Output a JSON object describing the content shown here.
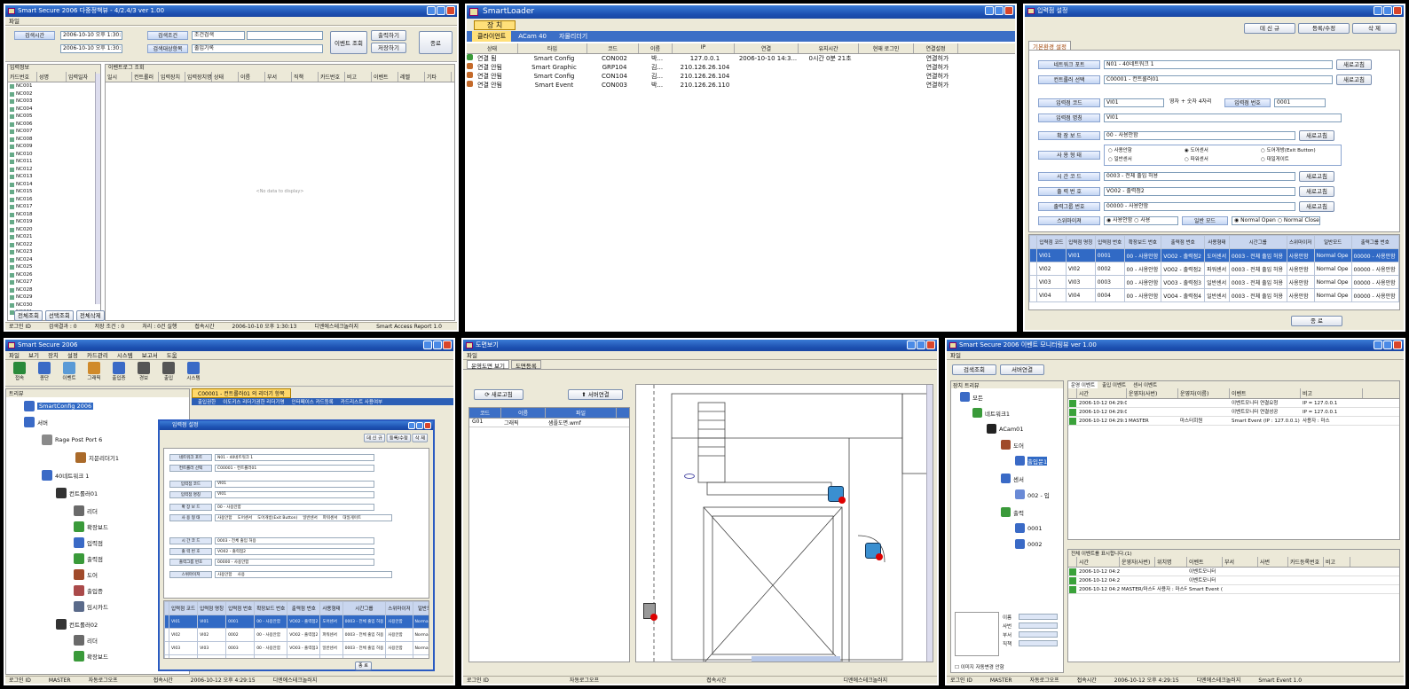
{
  "p1": {
    "title": "Smart Secure 2006 다중정책뷰 - 4/2.4/3 ver 1.00",
    "menu": "파일",
    "labels": {
      "start": "검색시간",
      "end": "",
      "device": "검색조건",
      "group": "검색대상항목"
    },
    "start_val": "2006-10-10 오후 1:30:13",
    "end_val": "2006-10-10 오후 1:30:13",
    "s1": "조건검색",
    "s2": "출입기록",
    "btn_search": "이벤트 조회",
    "btn_print": "출력하기",
    "btn_excel": "저장하기",
    "btn_close": "종료",
    "left_header": [
      "카드번호",
      "성명",
      "입력일자"
    ],
    "tab": "입력정보",
    "right_tab": "이벤트로그 조회",
    "cols": [
      "일시",
      "컨트롤러",
      "입력장치",
      "입력장치명",
      "상태",
      "이름",
      "부서",
      "직책",
      "카드번호",
      "비고",
      "이벤트",
      "레벨",
      "기타"
    ],
    "rows": [
      "NC001",
      "NC002",
      "NC003",
      "NC004",
      "NC005",
      "NC006",
      "NC007",
      "NC008",
      "NC009",
      "NC010",
      "NC011",
      "NC012",
      "NC013",
      "NC014",
      "NC015",
      "NC016",
      "NC017",
      "NC018",
      "NC019",
      "NC020",
      "NC021",
      "NC022",
      "NC023",
      "NC024",
      "NC025",
      "NC026",
      "NC027",
      "NC028",
      "NC029",
      "NC030",
      "NC031"
    ],
    "empty": "<No data to display>",
    "btns": [
      "전체조회",
      "선택조회",
      "전체삭제"
    ],
    "status": [
      "로그인 ID",
      "검색결과 : 0",
      "저장 조건 : 0",
      "처리 : 0건 실행",
      "접속시간",
      "2006-10-10 오후 1:30:13",
      "디엔에스테크놀러지",
      "Smart Access Report 1.0"
    ]
  },
  "p2": {
    "title": "SmartLoader",
    "tab_top": "장 치",
    "tabs": [
      "클라이언트",
      "ACam 40",
      "자물리더기"
    ],
    "cols": [
      "상태",
      "타입",
      "코드",
      "이름",
      "IP",
      "연결",
      "유지시간",
      "현재 로그인",
      "연결설정"
    ],
    "rows": [
      [
        "연결 됨",
        "Smart Config",
        "CON002",
        "박...",
        "127.0.0.1",
        "2006-10-10 14:3...",
        "0시간 0분 21초",
        "",
        "연결허가"
      ],
      [
        "연결 안됨",
        "Smart Graphic",
        "GRP104",
        "김...",
        "210.126.26.104",
        "",
        "",
        "",
        "연결허가"
      ],
      [
        "연결 안됨",
        "Smart Config",
        "CON104",
        "김...",
        "210.126.26.104",
        "",
        "",
        "",
        "연결허가"
      ],
      [
        "연결 안됨",
        "Smart Event",
        "CON003",
        "박...",
        "210.126.26.110",
        "",
        "",
        "",
        "연결허가"
      ]
    ]
  },
  "p3": {
    "title": "입력점 설정",
    "btns": [
      "데 신 규",
      "등록/수정",
      "삭 제"
    ],
    "tab": "기본환경 설정",
    "f": {
      "net_lbl": "네트워크 포트",
      "net": "N01 - 40네트워크 1",
      "ctl_lbl": "컨트롤러 선택",
      "ctl": "C00001 - 컨트롤러01",
      "code_lbl": "입력점 코드",
      "code": "VI01",
      "code_hint": "영자 + 숫자 4자리",
      "no_lbl": "입력점 번호",
      "no": "0001",
      "name_lbl": "입력점 명칭",
      "name": "VI01",
      "exp_lbl": "확 장 보 드",
      "exp": "00 - 사용안함",
      "use_lbl": "사 용 형 태",
      "use_opts": [
        "사용안함",
        "도어센서",
        "도어개방(Exit Button)",
        "일반센서",
        "파워센서",
        "대일게이트"
      ],
      "time_lbl": "시 간 코 드",
      "time": "0003 - 전체 출입 허용",
      "out_lbl": "출 력 번 호",
      "out": "VO02 - 출력점2",
      "grp_lbl": "출력그룹 번호",
      "grp": "00000 - 사용안함",
      "sw_lbl": "스위마이져",
      "sw_opts": [
        "사용안함",
        "사용"
      ],
      "mode_lbl": "일반 모드",
      "mode_opts": [
        "Normal Open",
        "Normal Close"
      ],
      "refresh": "새로고침"
    },
    "cols": [
      "입력점 코드",
      "입력점 명칭",
      "입력점 번호",
      "확장보드 번호",
      "출력점 번호",
      "사용형태",
      "시간그룹",
      "스위마이저",
      "일반모드",
      "출력그룹 번호"
    ],
    "rows": [
      [
        "VI01",
        "VI01",
        "0001",
        "00 - 사용안함",
        "VO02 - 출력점2",
        "도어센서",
        "0003 - 전체 출입 허용",
        "사용안함",
        "Normal Ope",
        "00000 - 사용안함"
      ],
      [
        "VI02",
        "VI02",
        "0002",
        "00 - 사용안함",
        "VO02 - 출력점2",
        "파워센서",
        "0003 - 전체 출입 허용",
        "사용안함",
        "Normal Ope",
        "00000 - 사용안함"
      ],
      [
        "VI03",
        "VI03",
        "0003",
        "00 - 사용안함",
        "VO03 - 출력점3",
        "일반센서",
        "0003 - 전체 출입 허용",
        "사용안함",
        "Normal Ope",
        "00000 - 사용안함"
      ],
      [
        "VI04",
        "VI04",
        "0004",
        "00 - 사용안함",
        "VO04 - 출력점4",
        "일반센서",
        "0003 - 전체 출입 허용",
        "사용안함",
        "Normal Ope",
        "00000 - 사용안함"
      ]
    ],
    "close": "종 료"
  },
  "p4": {
    "title": "Smart Secure 2006",
    "menu": [
      "파일",
      "보기",
      "장치",
      "설정",
      "카드관리",
      "시스템",
      "보고서",
      "도움"
    ],
    "tools": [
      "접속",
      "종단",
      "이벤트",
      "그래픽",
      "출입증",
      "경보",
      "출입",
      "시스템"
    ],
    "left_tab": "트리뷰",
    "tree": [
      "SmartConfig 2006",
      "서버",
      "Rage Post Port 6",
      "지문리더기1",
      "40네트워크 1",
      "컨트롤러01",
      "리더",
      "확장보드",
      "입력점",
      "출력점",
      "도어",
      "출입증",
      "임시카드",
      "컨트롤러02",
      "리더",
      "확장보드"
    ],
    "right_tab": "C00001 - 컨트롤러01 의 리더기 항목",
    "right_tabs": [
      "출입권한",
      "이도키스 리더기권한 리더기명",
      "인터페이스 카드등록",
      "카드리스트 사용여부"
    ],
    "status": [
      "로그인 ID",
      "MASTER",
      "자동로그오프",
      "",
      "접속시간",
      "2006-10-12 오후 4:29:15",
      "디엔에스테크놀러지"
    ]
  },
  "p5": {
    "title": "도면보기",
    "menu": "파일",
    "tabs": [
      "운영도면 보기",
      "도면등록"
    ],
    "btn_refresh": "새로고침",
    "btn_conn": "서버연결",
    "cols": [
      "코드",
      "이름",
      "파일"
    ],
    "row": [
      "G01",
      "그래픽",
      "샘플도면.wmf"
    ],
    "status": [
      "로그인 ID",
      "자동로그오프",
      "접속시간",
      "디엔에스테크놀러지"
    ]
  },
  "p6": {
    "title": "Smart Secure 2006 이벤트 모니터링뷰 ver 1.00",
    "menu": "파일",
    "btns": [
      "검색조회",
      "서버연결"
    ],
    "tree_tab": "장치 트리뷰",
    "tree": [
      "모든",
      "네트워크1",
      "ACam01",
      "도어",
      "출입문1",
      "센서",
      "002 - 입",
      "출력",
      "0001",
      "0002"
    ],
    "top_tabs": [
      "운영 이벤트",
      "출입 이벤트",
      "센서 이벤트"
    ],
    "top_cols": [
      "",
      "시간",
      "운영자(사번)",
      "운영자(이름)",
      "이벤트",
      "비고"
    ],
    "top_rows": [
      [
        "2006-10-12 04:29:00",
        "",
        "",
        "이벤트모니터 연결요청",
        "IP = 127.0.0.1"
      ],
      [
        "2006-10-12 04:29:00",
        "",
        "",
        "이벤트모니터 연결성공",
        "IP = 127.0.0.1"
      ],
      [
        "2006-10-12 04:29:15",
        "MASTER",
        "마스터회원",
        "Smart Event (IP : 127.0.0.1)",
        "사용자 : 마스"
      ]
    ],
    "bot_tab": "전체 이벤트를 표시합니다.(1)",
    "bot_cols": [
      "",
      "시간",
      "운영자(사번)",
      "위치명",
      "이벤트",
      "부서",
      "사번",
      "카드등록번호",
      "비고"
    ],
    "bot_rows": [
      [
        "2006-10-12 04:21:?",
        "",
        "",
        "이벤트모니터",
        "",
        "",
        "",
        ""
      ],
      [
        "2006-10-12 04:21:?",
        "",
        "",
        "이벤트모니터",
        "",
        "",
        "",
        ""
      ],
      [
        "2006-10-12 04:2",
        "MASTER/마스터",
        "사용자 : 마스터",
        "Smart Event (IP",
        "",
        "",
        "",
        ""
      ]
    ],
    "side": [
      "이름",
      "사번",
      "부서",
      "직책"
    ],
    "chk": "이미지 자동변경 안함",
    "status": [
      "로그인 ID",
      "MASTER",
      "자동로그오프",
      "접속시간",
      "2006-10-12 오후 4:29:15",
      "디엔에스테크놀러지",
      "Smart Event 1.0"
    ]
  }
}
